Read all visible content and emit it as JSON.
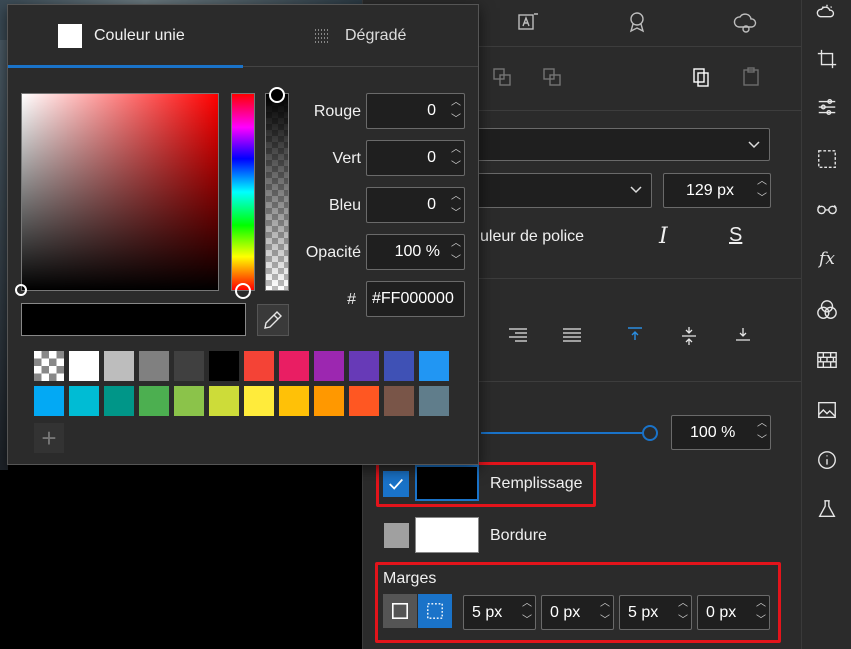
{
  "picker": {
    "tab_solid": "Couleur unie",
    "tab_gradient": "Dégradé",
    "red_label": "Rouge",
    "red_value": "0",
    "green_label": "Vert",
    "green_value": "0",
    "blue_label": "Bleu",
    "blue_value": "0",
    "opacity_label": "Opacité",
    "opacity_value": "100 %",
    "hex_label": "#",
    "hex_value": "#FF000000",
    "swatch_row1": [
      "checker",
      "#ffffff",
      "#bdbdbd",
      "#808080",
      "#404040",
      "#000000",
      "#f44336",
      "#e91e63",
      "#9c27b0",
      "#673ab7",
      "#3f51b5",
      "#2196f3"
    ],
    "swatch_row2": [
      "#03a9f4",
      "#00bcd4",
      "#009688",
      "#4caf50",
      "#8bc34a",
      "#cddc39",
      "#ffeb3b",
      "#ffc107",
      "#ff9800",
      "#ff5722",
      "#795548",
      "#607d8b"
    ],
    "add_swatch_glyph": "+"
  },
  "props": {
    "font_size_value": "129 px",
    "font_color_label": "uleur de police",
    "italic_glyph": "I",
    "strike_glyph": "S",
    "opacity_value": "100 %",
    "fill_label": "Remplissage",
    "fill_checked": true,
    "fill_color": "#000000",
    "border_label": "Bordure",
    "border_color": "#ffffff",
    "margins_label": "Marges",
    "margin_values": [
      "5 px",
      "0 px",
      "5 px",
      "0 px"
    ]
  },
  "tools": [
    "weather-icon",
    "crop-icon",
    "adjust-icon",
    "selection-icon",
    "glasses-icon",
    "fx-icon",
    "blend-icon",
    "texture-icon",
    "image-icon",
    "info-icon",
    "flask-icon"
  ],
  "tool_fx_text": "fx",
  "colors": {
    "accent": "#1a73c9",
    "highlight": "#e3141b"
  }
}
